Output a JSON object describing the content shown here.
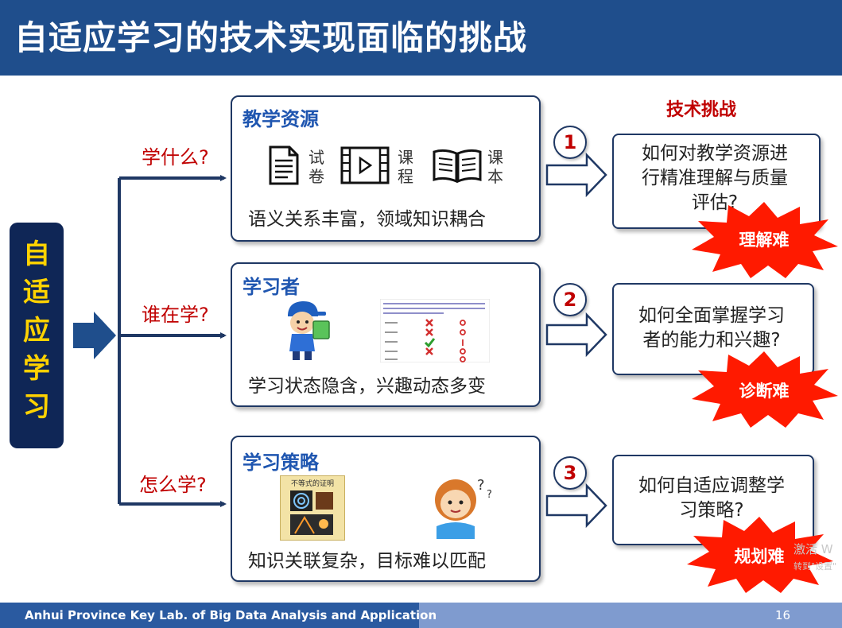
{
  "header": {
    "title": "自适应学习的技术实现面临的挑战"
  },
  "side": {
    "chars": [
      "自",
      "适",
      "应",
      "学",
      "习"
    ]
  },
  "questions": [
    "学什么?",
    "谁在学?",
    "怎么学?"
  ],
  "tech_title": "技术挑战",
  "cards": [
    {
      "title": "教学资源",
      "desc": "语义关系丰富，领域知识耦合",
      "resources": [
        {
          "icon": "document-icon",
          "label": "试卷"
        },
        {
          "icon": "video-icon",
          "label": "课程"
        },
        {
          "icon": "book-icon",
          "label": "课本"
        }
      ]
    },
    {
      "title": "学习者",
      "desc": "学习状态隐含，兴趣动态多变"
    },
    {
      "title": "学习策略",
      "desc": "知识关联复杂，目标难以匹配",
      "poster_title": "不等式的证明"
    }
  ],
  "challenges": [
    {
      "num": "1",
      "line1": "如何对教学资源进",
      "line2": "行精准理解与质量",
      "line3": "评估?",
      "badge": "理解难"
    },
    {
      "num": "2",
      "line1": "如何全面掌握学习",
      "line2": "者的能力和兴趣?",
      "badge": "诊断难"
    },
    {
      "num": "3",
      "line1": "如何自适应调整学",
      "line2": "习策略?",
      "badge": "规划难"
    }
  ],
  "footer": {
    "lab": "Anhui Province Key Lab. of Big Data Analysis and Application",
    "page": "16"
  },
  "watermark": {
    "line1": "激活 W",
    "line2": "转到\"设置\""
  },
  "colors": {
    "header": "#1f4e8c",
    "accent_red": "#c00000",
    "dark_navy": "#0f2656",
    "burst": "#ff1a00",
    "side_text": "#ffd200"
  }
}
